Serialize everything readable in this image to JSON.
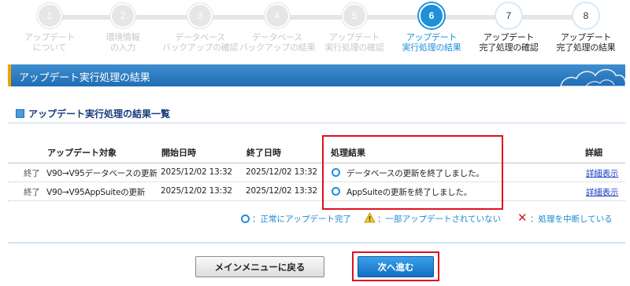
{
  "stepper": {
    "steps": [
      {
        "num": "1",
        "line1": "アップデート",
        "line2": "について",
        "state": "done"
      },
      {
        "num": "2",
        "line1": "環境情報",
        "line2": "の入力",
        "state": "done"
      },
      {
        "num": "3",
        "line1": "データベース",
        "line2": "バックアップの確認",
        "state": "done"
      },
      {
        "num": "4",
        "line1": "データベース",
        "line2": "バックアップの結果",
        "state": "done"
      },
      {
        "num": "5",
        "line1": "アップデート",
        "line2": "実行処理の確認",
        "state": "done"
      },
      {
        "num": "6",
        "line1": "アップデート",
        "line2": "実行処理の結果",
        "state": "current"
      },
      {
        "num": "7",
        "line1": "アップデート",
        "line2": "完了処理の確認",
        "state": "future"
      },
      {
        "num": "8",
        "line1": "アップデート",
        "line2": "完了処理の結果",
        "state": "future"
      }
    ]
  },
  "banner": {
    "title": "アップデート実行処理の結果"
  },
  "section": {
    "title": "アップデート実行処理の結果一覧"
  },
  "table": {
    "headers": {
      "target": "アップデート対象",
      "start": "開始日時",
      "end": "終了日時",
      "result": "処理結果",
      "detail": "詳細"
    },
    "rows": [
      {
        "status": "終了",
        "target": "V90→V95データベースの更新",
        "start": "2025/12/02 13:32",
        "end": "2025/12/02 13:32",
        "result": "データベースの更新を終了しました。",
        "detail": "詳細表示"
      },
      {
        "status": "終了",
        "target": "V90→V95AppSuiteの更新",
        "start": "2025/12/02 13:32",
        "end": "2025/12/02 13:32",
        "result": "AppSuiteの更新を終了しました。",
        "detail": "詳細表示"
      }
    ]
  },
  "legend": {
    "ok": "：正常にアップデート完了",
    "warn": "：一部アップデートされていない",
    "error": "：処理を中断している"
  },
  "buttons": {
    "back": "メインメニューに戻る",
    "next": "次へ進む"
  },
  "colors": {
    "accent": "#1e90d8",
    "banner": "#2a7cc3",
    "highlight": "#e01020",
    "error": "#d0202a",
    "warning": "#f0c020"
  }
}
